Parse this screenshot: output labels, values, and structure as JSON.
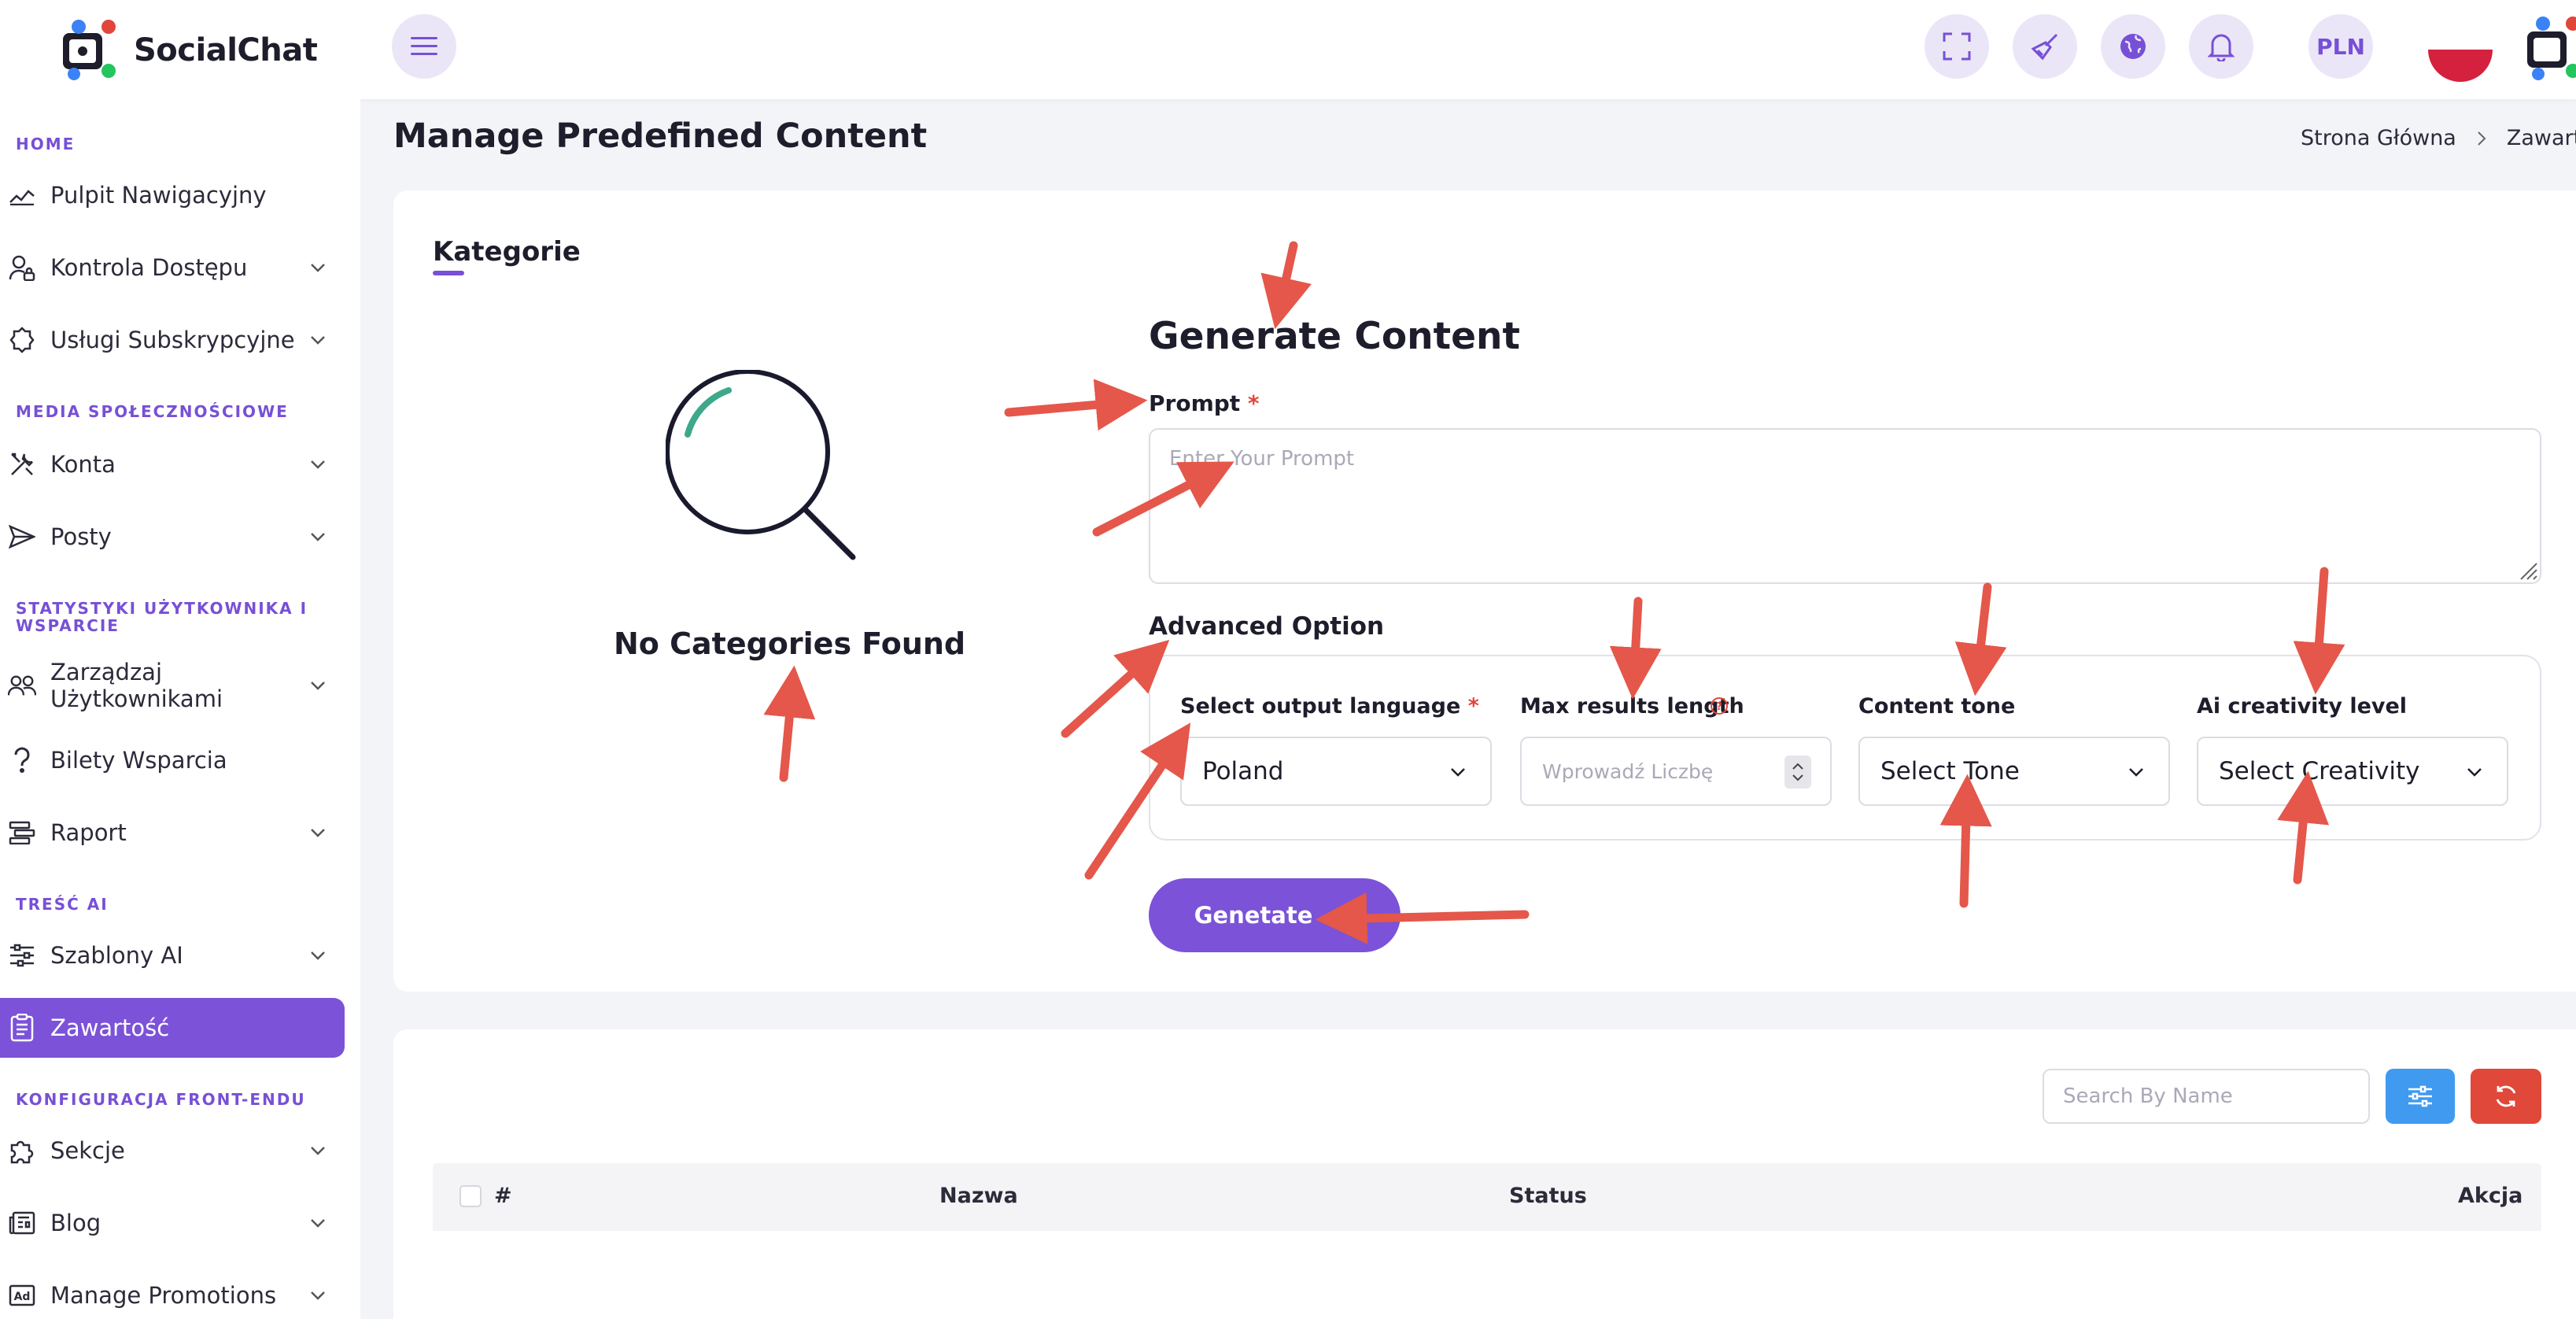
{
  "app": {
    "name": "SocialChat"
  },
  "topbar": {
    "currency": "PLN"
  },
  "sidebar": {
    "sections": [
      {
        "title": "HOME",
        "items": [
          {
            "label": "Pulpit Nawigacyjny",
            "icon": "chart-line-icon",
            "has_chevron": false
          },
          {
            "label": "Kontrola Dostępu",
            "icon": "user-lock-icon",
            "has_chevron": true
          },
          {
            "label": "Usługi Subskrypcyjne",
            "icon": "badge-icon",
            "has_chevron": true
          }
        ]
      },
      {
        "title": "MEDIA SPOŁECZNOŚCIOWE",
        "items": [
          {
            "label": "Konta",
            "icon": "tools-icon",
            "has_chevron": true
          },
          {
            "label": "Posty",
            "icon": "send-icon",
            "has_chevron": true
          }
        ]
      },
      {
        "title": "STATYSTYKI UŻYTKOWNIKA I WSPARCIE",
        "items": [
          {
            "label": "Zarządzaj Użytkownikami",
            "icon": "users-icon",
            "has_chevron": true
          },
          {
            "label": "Bilety Wsparcia",
            "icon": "question-icon",
            "has_chevron": false
          },
          {
            "label": "Raport",
            "icon": "report-icon",
            "has_chevron": true
          }
        ]
      },
      {
        "title": "TREŚĆ AI",
        "items": [
          {
            "label": "Szablony AI",
            "icon": "sliders-icon",
            "has_chevron": true
          },
          {
            "label": "Zawartość",
            "icon": "clipboard-icon",
            "has_chevron": false,
            "active": true
          }
        ]
      },
      {
        "title": "KONFIGURACJA FRONT-ENDU",
        "items": [
          {
            "label": "Sekcje",
            "icon": "puzzle-icon",
            "has_chevron": true
          },
          {
            "label": "Blog",
            "icon": "newspaper-icon",
            "has_chevron": true
          },
          {
            "label": "Manage Promotions",
            "icon": "ad-icon",
            "has_chevron": true
          }
        ]
      }
    ]
  },
  "page": {
    "title": "Manage Predefined Content",
    "breadcrumb": {
      "home": "Strona Główna",
      "current": "Zawartość"
    }
  },
  "categories": {
    "tab_label": "Kategorie",
    "empty_text": "No Categories Found"
  },
  "generator": {
    "title": "Generate Content",
    "prompt_label": "Prompt",
    "prompt_required": "*",
    "prompt_placeholder": "Enter Your Prompt",
    "advanced_title": "Advanced Option",
    "language_label": "Select output language",
    "language_required": "*",
    "language_value": "Poland",
    "max_length_label": "Max results length",
    "max_length_placeholder": "Wprowadź Liczbę",
    "tone_label": "Content tone",
    "tone_value": "Select Tone",
    "creativity_label": "Ai creativity level",
    "creativity_value": "Select Creativity",
    "submit_label": "Genetate"
  },
  "table": {
    "search_placeholder": "Search By Name",
    "columns": [
      "#",
      "Nazwa",
      "Status",
      "Akcja"
    ]
  },
  "colors": {
    "accent": "#7b52d8",
    "annotation_arrow": "#e4574a",
    "filter_button": "#3f9af0",
    "refresh_button": "#e0483a"
  }
}
